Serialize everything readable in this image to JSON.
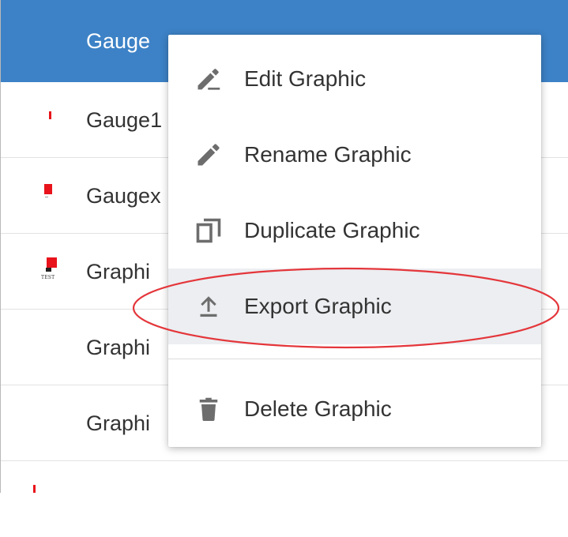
{
  "table": {
    "header_label": "Gauge",
    "rows": [
      {
        "label": "Gauge1"
      },
      {
        "label": "Gaugex"
      },
      {
        "label": "Graphi",
        "thumb_text": "TEST"
      },
      {
        "label": "Graphi"
      },
      {
        "label": "Graphi"
      }
    ]
  },
  "context_menu": {
    "items": [
      {
        "label": "Edit Graphic",
        "icon": "edit-underline-icon"
      },
      {
        "label": "Rename Graphic",
        "icon": "pencil-icon"
      },
      {
        "label": "Duplicate Graphic",
        "icon": "duplicate-icon"
      },
      {
        "label": "Export Graphic",
        "icon": "upload-icon",
        "highlighted": true
      },
      {
        "label": "Delete Graphic",
        "icon": "trash-icon"
      }
    ]
  },
  "colors": {
    "header": "#3d82c6",
    "icon": "#6d6d6d",
    "thumbnail_red": "#e8131b",
    "annotation_red": "#e4363b",
    "hover": "#eceef1"
  }
}
